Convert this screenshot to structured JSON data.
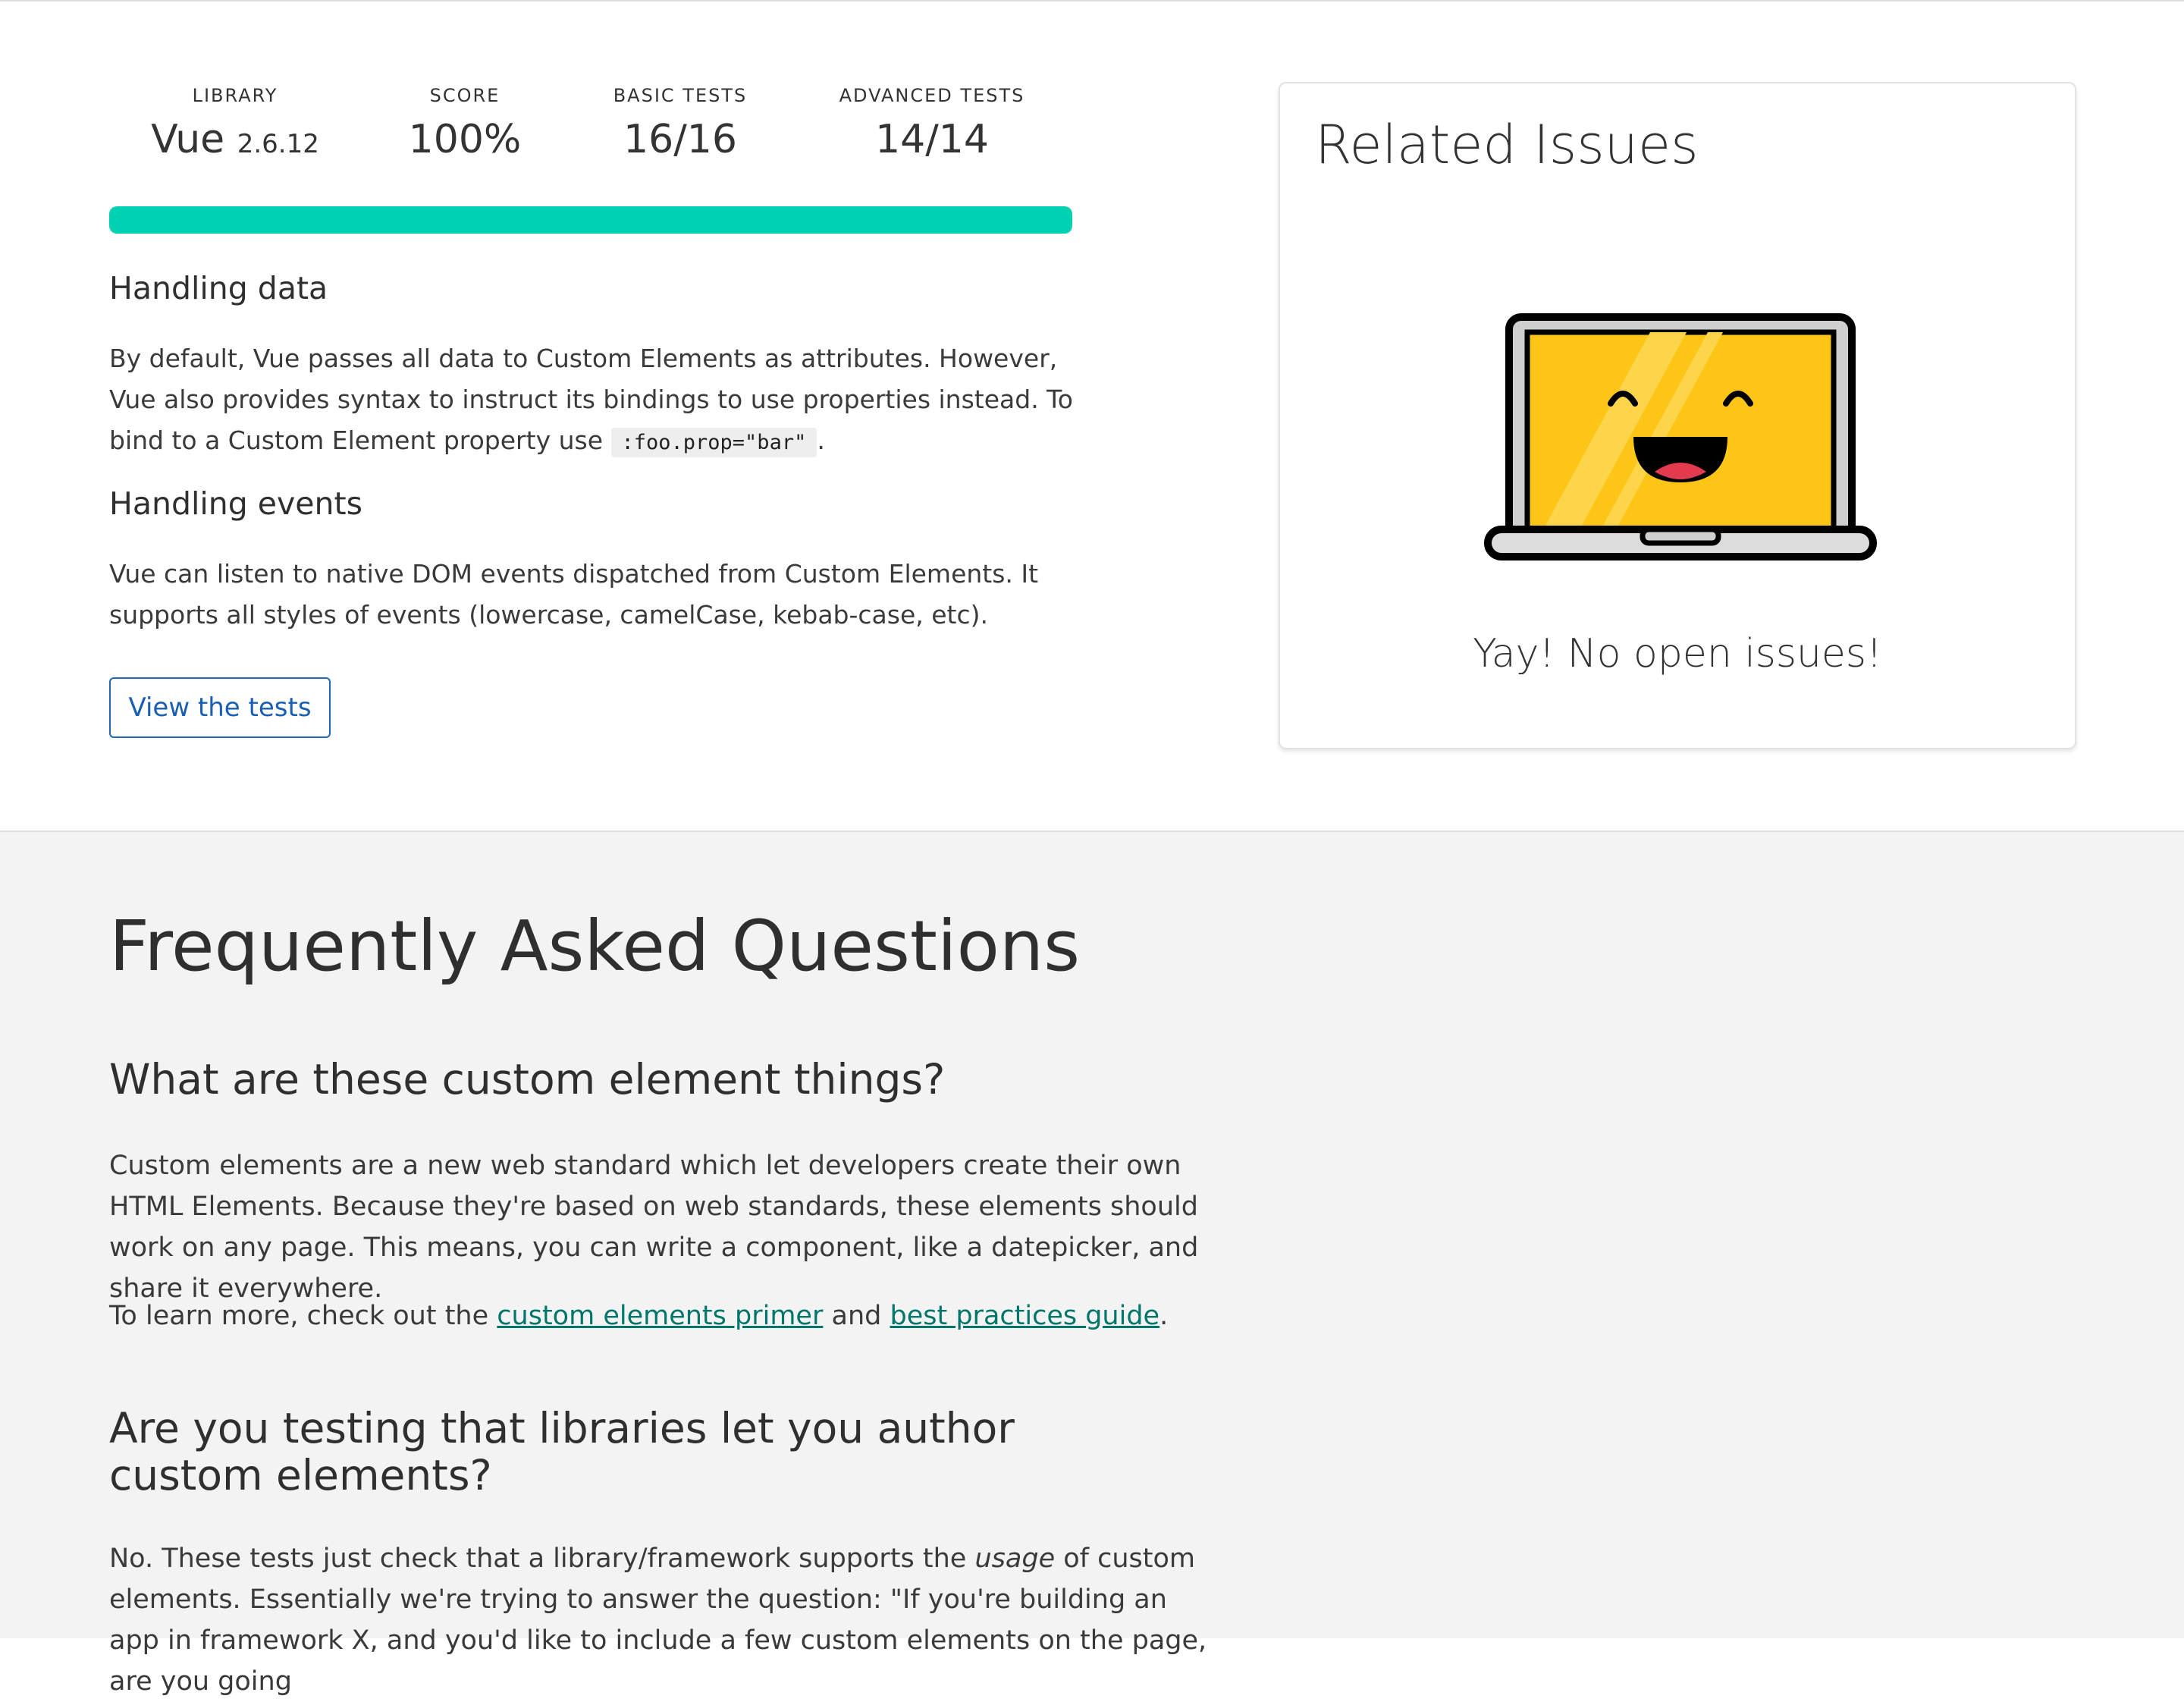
{
  "stats": [
    {
      "label": "LIBRARY",
      "value": "Vue",
      "version": "2.6.12"
    },
    {
      "label": "SCORE",
      "value": "100%"
    },
    {
      "label": "BASIC TESTS",
      "value": "16/16"
    },
    {
      "label": "ADVANCED TESTS",
      "value": "14/14"
    }
  ],
  "progress": {
    "percent": 100,
    "color": "#00d1b2"
  },
  "handling_data": {
    "heading": "Handling data",
    "text_before": "By default, Vue passes all data to Custom Elements as attributes. However, Vue also provides syntax to instruct its bindings to use properties instead. To bind to a Custom Element property use",
    "code": ":foo.prop=\"bar\"",
    "text_after": "."
  },
  "handling_events": {
    "heading": "Handling events",
    "text": "Vue can listen to native DOM events dispatched from Custom Elements. It supports all styles of events (lowercase, camelCase, kebab-case, etc)."
  },
  "tests_button": {
    "label": "View the tests"
  },
  "related_issues": {
    "title": "Related Issues",
    "illustration": "happy-laptop-icon",
    "message": "Yay! No open issues!"
  },
  "faq": {
    "title": "Frequently Asked Questions",
    "q1": {
      "question": "What are these custom element things?",
      "answer": "Custom elements are a new web standard which let developers create their own HTML Elements. Because they're based on web standards, these elements should work on any page. This means, you can write a component, like a datepicker, and share it everywhere.",
      "learn_more_prefix": "To learn more, check out the",
      "link1": "custom elements primer",
      "and": "and",
      "link2": "best practices guide",
      "suffix": "."
    },
    "q2": {
      "question": "Are you testing that libraries let you author custom elements?",
      "answer_prefix": "No. These tests just check that a library/framework supports the",
      "answer_emphasis": "usage",
      "answer_rest": "of custom elements. Essentially we're trying to answer the question: \"If you're building an app in framework X, and you'd like to include a few custom elements on the page, are you going"
    }
  },
  "colors": {
    "accent": "#00d1b2",
    "link": "#00766a",
    "button": "#1a5fb4",
    "faq_background": "#f3f3f3"
  }
}
